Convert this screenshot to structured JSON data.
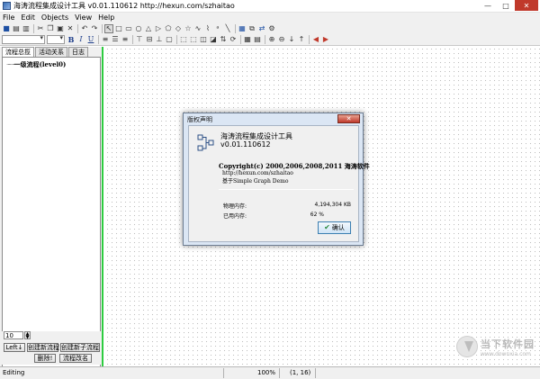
{
  "window": {
    "title": "海涛流程集成设计工具 v0.01.110612 http://hexun.com/szhaitao",
    "minimize": "—",
    "maximize": "□",
    "close": "✕"
  },
  "menu": [
    "File",
    "Edit",
    "Objects",
    "View",
    "Help"
  ],
  "left_panel": {
    "tabs": [
      "流程总揽",
      "活动关系",
      "日志"
    ],
    "tree_item_prefix": "·······",
    "tree_item": "一级流程(level0)",
    "zoom_value": "10",
    "buttons": {
      "left": "Left↓",
      "new_flow": "创建新流程",
      "new_subflow": "创建新子流程",
      "delete": "删除!",
      "rename": "流程改名"
    }
  },
  "dialog": {
    "title": "版权声明",
    "app_name": "海涛流程集成设计工具",
    "version": "v0.01.110612",
    "copyright": "Copyright(c) 2000,2006,2008,2011 海涛软件",
    "url": "http://hexun.com/szhaitao",
    "based_on": "基于Simple Graph Demo",
    "physical_memory_label": "物理内存:",
    "physical_memory_value": "4,194,304 KB",
    "used_memory_label": "已用内存:",
    "used_memory_value": "62 %",
    "ok_label": "确认"
  },
  "status": {
    "mode": "Editing",
    "zoom": "100%",
    "coords": "(1, 16)"
  },
  "watermark": {
    "line1": "当下软件园",
    "line2": "www.downxia.com"
  }
}
